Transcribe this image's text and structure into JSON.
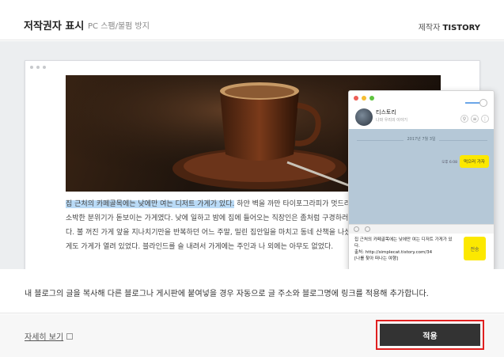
{
  "header": {
    "title": "저작권자 표시",
    "subtitle": "PC 스팸/불펌 방지",
    "maker_label": "제작자",
    "maker_name": "TISTORY"
  },
  "preview": {
    "article_highlight": "집 근처의 카페골목에는 낮에만 여는 디저트 가게가 있다.",
    "article_rest": " 하얀 벽을 까만 타이포그라피가 멋드러지게 꾸며진 소박한 분위기가 돋보이는 가게였다. 낮에 일하고 밤에 집에 들어오는 직장인은 좀처럼 구경하러 갈 수가 없다. 불 꺼진 가게 앞을 지나치기만을 반복하던 어느 주말, 밀린 집안일을 마치고 동네 산책을 나섰더니 별스럽게도 가게가 열려 있었다. 블라인드를 슬 내려서 가게에는 주인과 나 외에는 아무도 없었다.",
    "chat": {
      "name": "티스토리",
      "description": "나와 우리의 이야기",
      "date": "2017년 7월 3일",
      "message_time": "오후 6:08",
      "message": "먹으러 가자",
      "input_text": "집 근처의 카페골목에는 낮에만 여는 디저트 가게가 있다.\n출처: http://simplecat.tistory.com/34\n[나를 찾아 떠나는 여행]",
      "send_label": "전송"
    }
  },
  "description": "내 블로그의 글을 복사해 다른 블로그나 게시판에 붙여넣을 경우 자동으로 글 주소와 블로그명에 링크를 적용해 추가합니다.",
  "footer": {
    "more_link": "자세히 보기",
    "apply_label": "적용"
  },
  "colors": {
    "apply_bg": "#333333",
    "highlight_frame": "#e02020",
    "chat_bg": "#b5c8d7",
    "kakao_yellow": "#fce800"
  }
}
